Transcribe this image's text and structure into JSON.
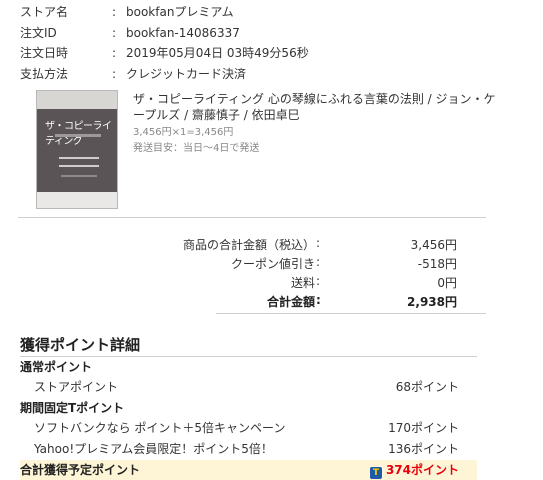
{
  "order": {
    "store_label": "ストア名",
    "store_value": "bookfanプレミアム",
    "id_label": "注文ID",
    "id_value": "bookfan-14086337",
    "date_label": "注文日時",
    "date_value": "2019年05月04日 03時49分56秒",
    "payment_label": "支払方法",
    "payment_value": "クレジットカード決済",
    "separator": ":"
  },
  "product": {
    "title": "ザ・コピーライティング 心の琴線にふれる言葉の法則 / ジョン・ケープルズ / 齋藤慎子 / 依田卓巳",
    "price_line": "3,456円×1=3,456円",
    "shipping_note": "発送目安：当日～4日で発送",
    "cover_title": "ザ・コピーライティング"
  },
  "totals": {
    "subtotal_label": "商品の合計金額（税込）",
    "subtotal_value": "3,456円",
    "coupon_label": "クーポン値引き",
    "coupon_value": "-518円",
    "shipping_label": "送料",
    "shipping_value": "0円",
    "total_label": "合計金額",
    "total_value": "2,938円",
    "colon": ":"
  },
  "points": {
    "heading": "獲得ポイント詳細",
    "normal_label": "通常ポイント",
    "store_points_label": "ストアポイント",
    "store_points_value": "68ポイント",
    "limited_label": "期間固定Tポイント",
    "softbank_label": "ソフトバンクなら ポイント＋5倍キャンペーン",
    "softbank_value": "170ポイント",
    "yahoo_label": "Yahoo!プレミアム会員限定！ポイント5倍！",
    "yahoo_value": "136ポイント",
    "total_label": "合計獲得予定ポイント",
    "total_value": "374ポイント",
    "t_badge": "T"
  }
}
